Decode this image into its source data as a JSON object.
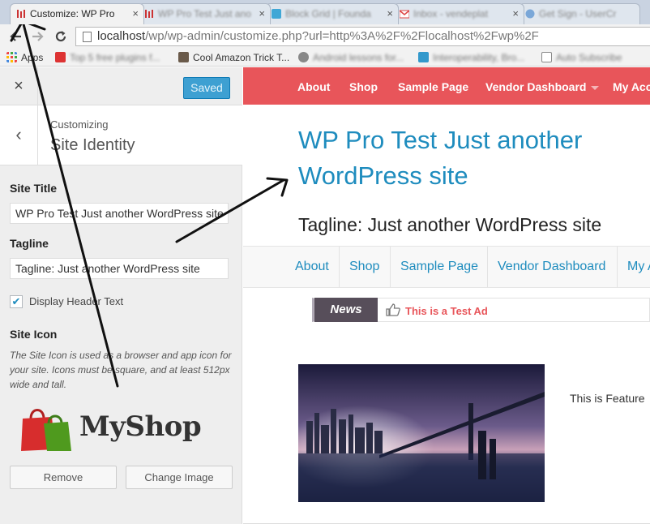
{
  "browser": {
    "tabs": [
      {
        "title": "Customize: WP Pro",
        "active": true
      },
      {
        "title": "WP Pro Test Just ano",
        "active": false
      },
      {
        "title": "Block Grid | Founda",
        "active": false
      },
      {
        "title": "Inbox - vendeplat",
        "active": false
      },
      {
        "title": "Get Sign - UserCr",
        "active": false
      }
    ],
    "tab_close_glyph": "×",
    "address": {
      "host": "localhost",
      "path": "/wp/wp-admin/customize.php?url=http%3A%2F%2Flocalhost%2Fwp%2F"
    },
    "bookmarks": [
      {
        "label": "Apps",
        "icon": "apps-grid-icon"
      },
      {
        "label": "Top 5 free plugins f...",
        "icon": "bookmark-favicon"
      },
      {
        "label": "Cool Amazon Trick T...",
        "icon": "bookmark-favicon"
      },
      {
        "label": "Android lessons for...",
        "icon": "bookmark-favicon"
      },
      {
        "label": "Interoperability, Bro...",
        "icon": "bookmark-favicon"
      },
      {
        "label": "Auto Subscribe",
        "icon": "page-icon"
      }
    ]
  },
  "customizer": {
    "close_glyph": "×",
    "save_label": "Saved",
    "back_glyph": "‹",
    "customizing_label": "Customizing",
    "section_title": "Site Identity",
    "site_title_label": "Site Title",
    "site_title_value": "WP Pro Test Just another WordPress site",
    "tagline_label": "Tagline",
    "tagline_value": "Tagline: Just another WordPress site",
    "display_header_text_label": "Display Header Text",
    "display_header_text_checked": true,
    "check_glyph": "✔",
    "site_icon_label": "Site Icon",
    "site_icon_description": "The Site Icon is used as a browser and app icon for your site. Icons must be square, and at least 512px wide and tall.",
    "logo_text": "MyShop",
    "remove_label": "Remove",
    "change_image_label": "Change Image"
  },
  "preview": {
    "top_menu": [
      "About",
      "Shop",
      "Sample Page",
      "Vendor Dashboard",
      "My Acc"
    ],
    "site_title": "WP Pro Test Just another WordPress site",
    "tagline": "Tagline: Just another WordPress site",
    "secondary_menu": [
      "About",
      "Shop",
      "Sample Page",
      "Vendor Dashboard",
      "My A"
    ],
    "news_badge": "News",
    "news_item": "This is a Test Ad",
    "featured_text": "This is Feature"
  },
  "colors": {
    "header_red": "#e8555a",
    "link_blue": "#1e8cbe",
    "save_button": "#3ea0d2",
    "news_badge": "#574e5a"
  }
}
